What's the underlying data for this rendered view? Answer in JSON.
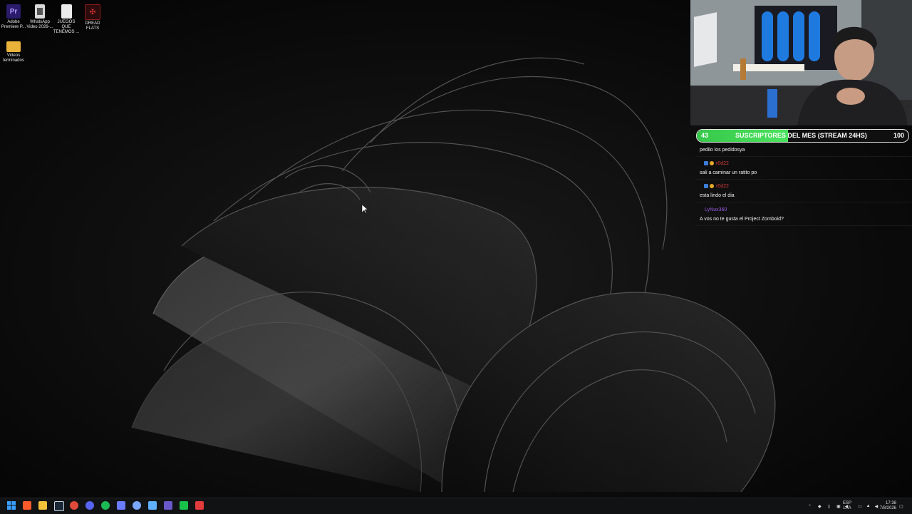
{
  "desktop": {
    "icons": [
      {
        "name": "Adobe Premiere Pro",
        "line1": "Adobe",
        "line2": "Premiere P...",
        "icon": "premiere-icon",
        "color": "#2a1b6b",
        "glyph": "Pr"
      },
      {
        "name": "WhatsApp Video",
        "line1": "WhatsApp",
        "line2": "Video 2026-...",
        "icon": "video-file-icon",
        "color": "#b9b9b9",
        "glyph": ""
      },
      {
        "name": "JUEGOS QUE TENEMOS",
        "line1": "JUEGOS QUE",
        "line2": "TENEMOS ...",
        "icon": "text-file-icon",
        "color": "#e9e9e9",
        "glyph": ""
      },
      {
        "name": "DREAD FLATS",
        "line1": "DREAD",
        "line2": "FLATS",
        "icon": "game-icon",
        "color": "#8a1a1a",
        "glyph": ""
      },
      {
        "name": "Videos terminados",
        "line1": "Videos",
        "line2": "terminados",
        "icon": "folder-icon",
        "color": "#e9b23a",
        "glyph": ""
      }
    ]
  },
  "overlay": {
    "goal": {
      "left_value": "43",
      "label": "SUSCRIPTORES DEL MES (STREAM 24HS)",
      "right_value": "100",
      "progress": 0.43
    },
    "chat": [
      {
        "type": "message",
        "text": "pedilo los pedidosya"
      },
      {
        "type": "user",
        "user": "r0d22",
        "color": "#d93a3a"
      },
      {
        "type": "message",
        "text": "sali a caminar un ratito po"
      },
      {
        "type": "user",
        "user": "r0d22",
        "color": "#d93a3a"
      },
      {
        "type": "message",
        "text": "esta lindo el dia"
      },
      {
        "type": "user",
        "user": "LyNux360",
        "color": "#9b5de5"
      },
      {
        "type": "message",
        "text": "A vos no te gusta el Project Zomboid?"
      }
    ]
  },
  "taskbar": {
    "apps": [
      {
        "icon": "windows-start-icon",
        "color": "#3aa0ff"
      },
      {
        "icon": "brave-browser-icon",
        "color": "#ff5a2a"
      },
      {
        "icon": "file-explorer-icon",
        "color": "#f3c13a"
      },
      {
        "icon": "steam-icon",
        "color": "#c7d5e0"
      },
      {
        "icon": "chrome-icon",
        "color": "#e04a3a"
      },
      {
        "icon": "discord-icon",
        "color": "#5865f2"
      },
      {
        "icon": "spotify-icon",
        "color": "#1db954"
      },
      {
        "icon": "monitor-app-icon",
        "color": "#6a7cff"
      },
      {
        "icon": "settings-icon",
        "color": "#7aa7ff"
      },
      {
        "icon": "controller-app-icon",
        "color": "#5fb0ff"
      },
      {
        "icon": "obs-app-icon",
        "color": "#6a58c9"
      },
      {
        "icon": "xbox-app-icon",
        "color": "#18c24a"
      },
      {
        "icon": "media-app-icon",
        "color": "#e23b3b"
      }
    ],
    "tray": {
      "lang_top": "ESP",
      "lang_bottom": "LAA",
      "time": "17:38",
      "date": "7/8/2026"
    }
  }
}
